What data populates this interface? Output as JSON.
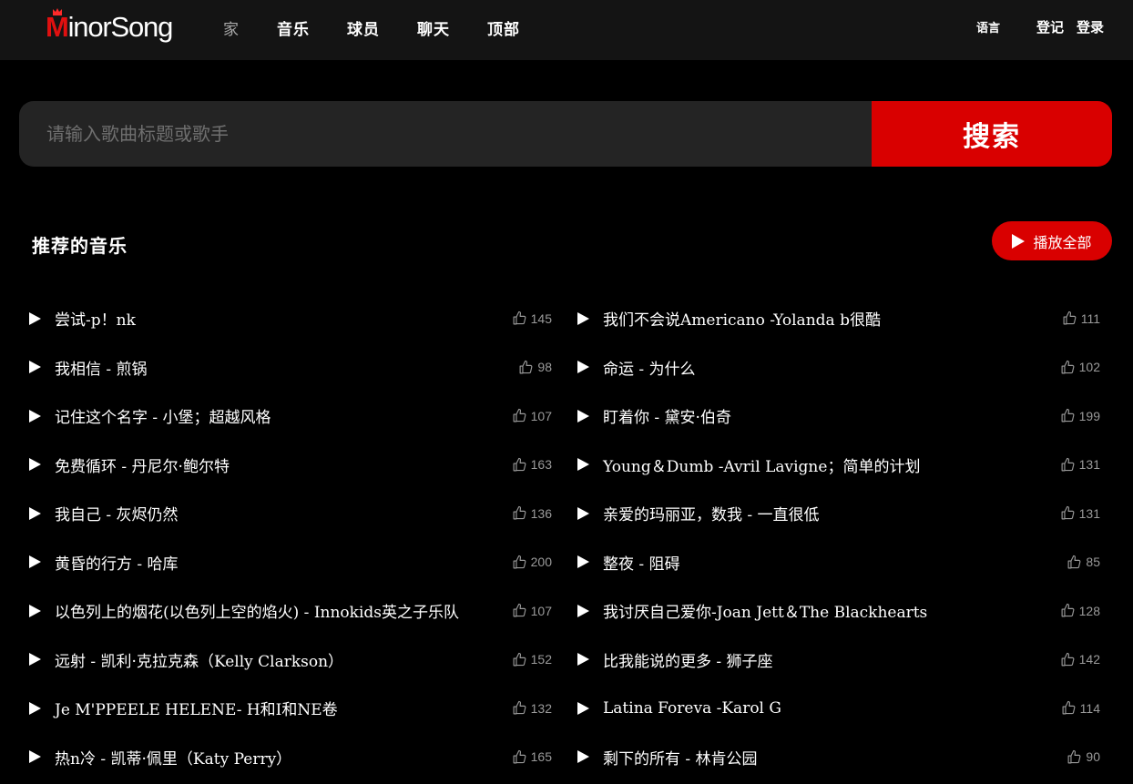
{
  "header": {
    "logo_first": "M",
    "logo_rest": "inorSong",
    "nav": [
      "家",
      "音乐",
      "球员",
      "聊天",
      "顶部"
    ],
    "language": "语言",
    "register": "登记",
    "login": "登录"
  },
  "search": {
    "placeholder": "请输入歌曲标题或歌手",
    "button": "搜索"
  },
  "section": {
    "title": "推荐的音乐",
    "play_all": "播放全部"
  },
  "colors": {
    "accent": "#d90000",
    "background": "#000000",
    "header_bg": "#141414",
    "input_bg": "#242424"
  },
  "songs_left": [
    {
      "title": "尝试-p！nk",
      "likes": "145"
    },
    {
      "title": "我相信 - 煎锅",
      "likes": "98"
    },
    {
      "title": "记住这个名字 - 小堡；超越风格",
      "likes": "107"
    },
    {
      "title": "免费循环 - 丹尼尔·鲍尔特",
      "likes": "163"
    },
    {
      "title": "我自己 - 灰烬仍然",
      "likes": "136"
    },
    {
      "title": "黄昏的行方 - 哈库",
      "likes": "200"
    },
    {
      "title": "以色列上的烟花(以色列上空的焰火) - Innokids英之子乐队",
      "likes": "107"
    },
    {
      "title": "远射 - 凯利·克拉克森（Kelly Clarkson）",
      "likes": "152"
    },
    {
      "title": "Je M'PPEELE HELENE- H和I和NE卷",
      "likes": "132"
    },
    {
      "title": "热n冷 - 凯蒂·佩里（Katy Perry）",
      "likes": "165"
    }
  ],
  "songs_right": [
    {
      "title": "我们不会说Americano -Yolanda b很酷",
      "likes": "111"
    },
    {
      "title": "命运 - 为什么",
      "likes": "102"
    },
    {
      "title": "盯着你 - 黛安·伯奇",
      "likes": "199"
    },
    {
      "title": "Young＆Dumb -Avril Lavigne；简单的计划",
      "likes": "131"
    },
    {
      "title": "亲爱的玛丽亚，数我 - 一直很低",
      "likes": "131"
    },
    {
      "title": "整夜 - 阻碍",
      "likes": "85"
    },
    {
      "title": "我讨厌自己爱你-Joan Jett＆The Blackhearts",
      "likes": "128"
    },
    {
      "title": "比我能说的更多 - 狮子座",
      "likes": "142"
    },
    {
      "title": "Latina Foreva -Karol G",
      "likes": "114"
    },
    {
      "title": "剩下的所有 - 林肯公园",
      "likes": "90"
    }
  ]
}
